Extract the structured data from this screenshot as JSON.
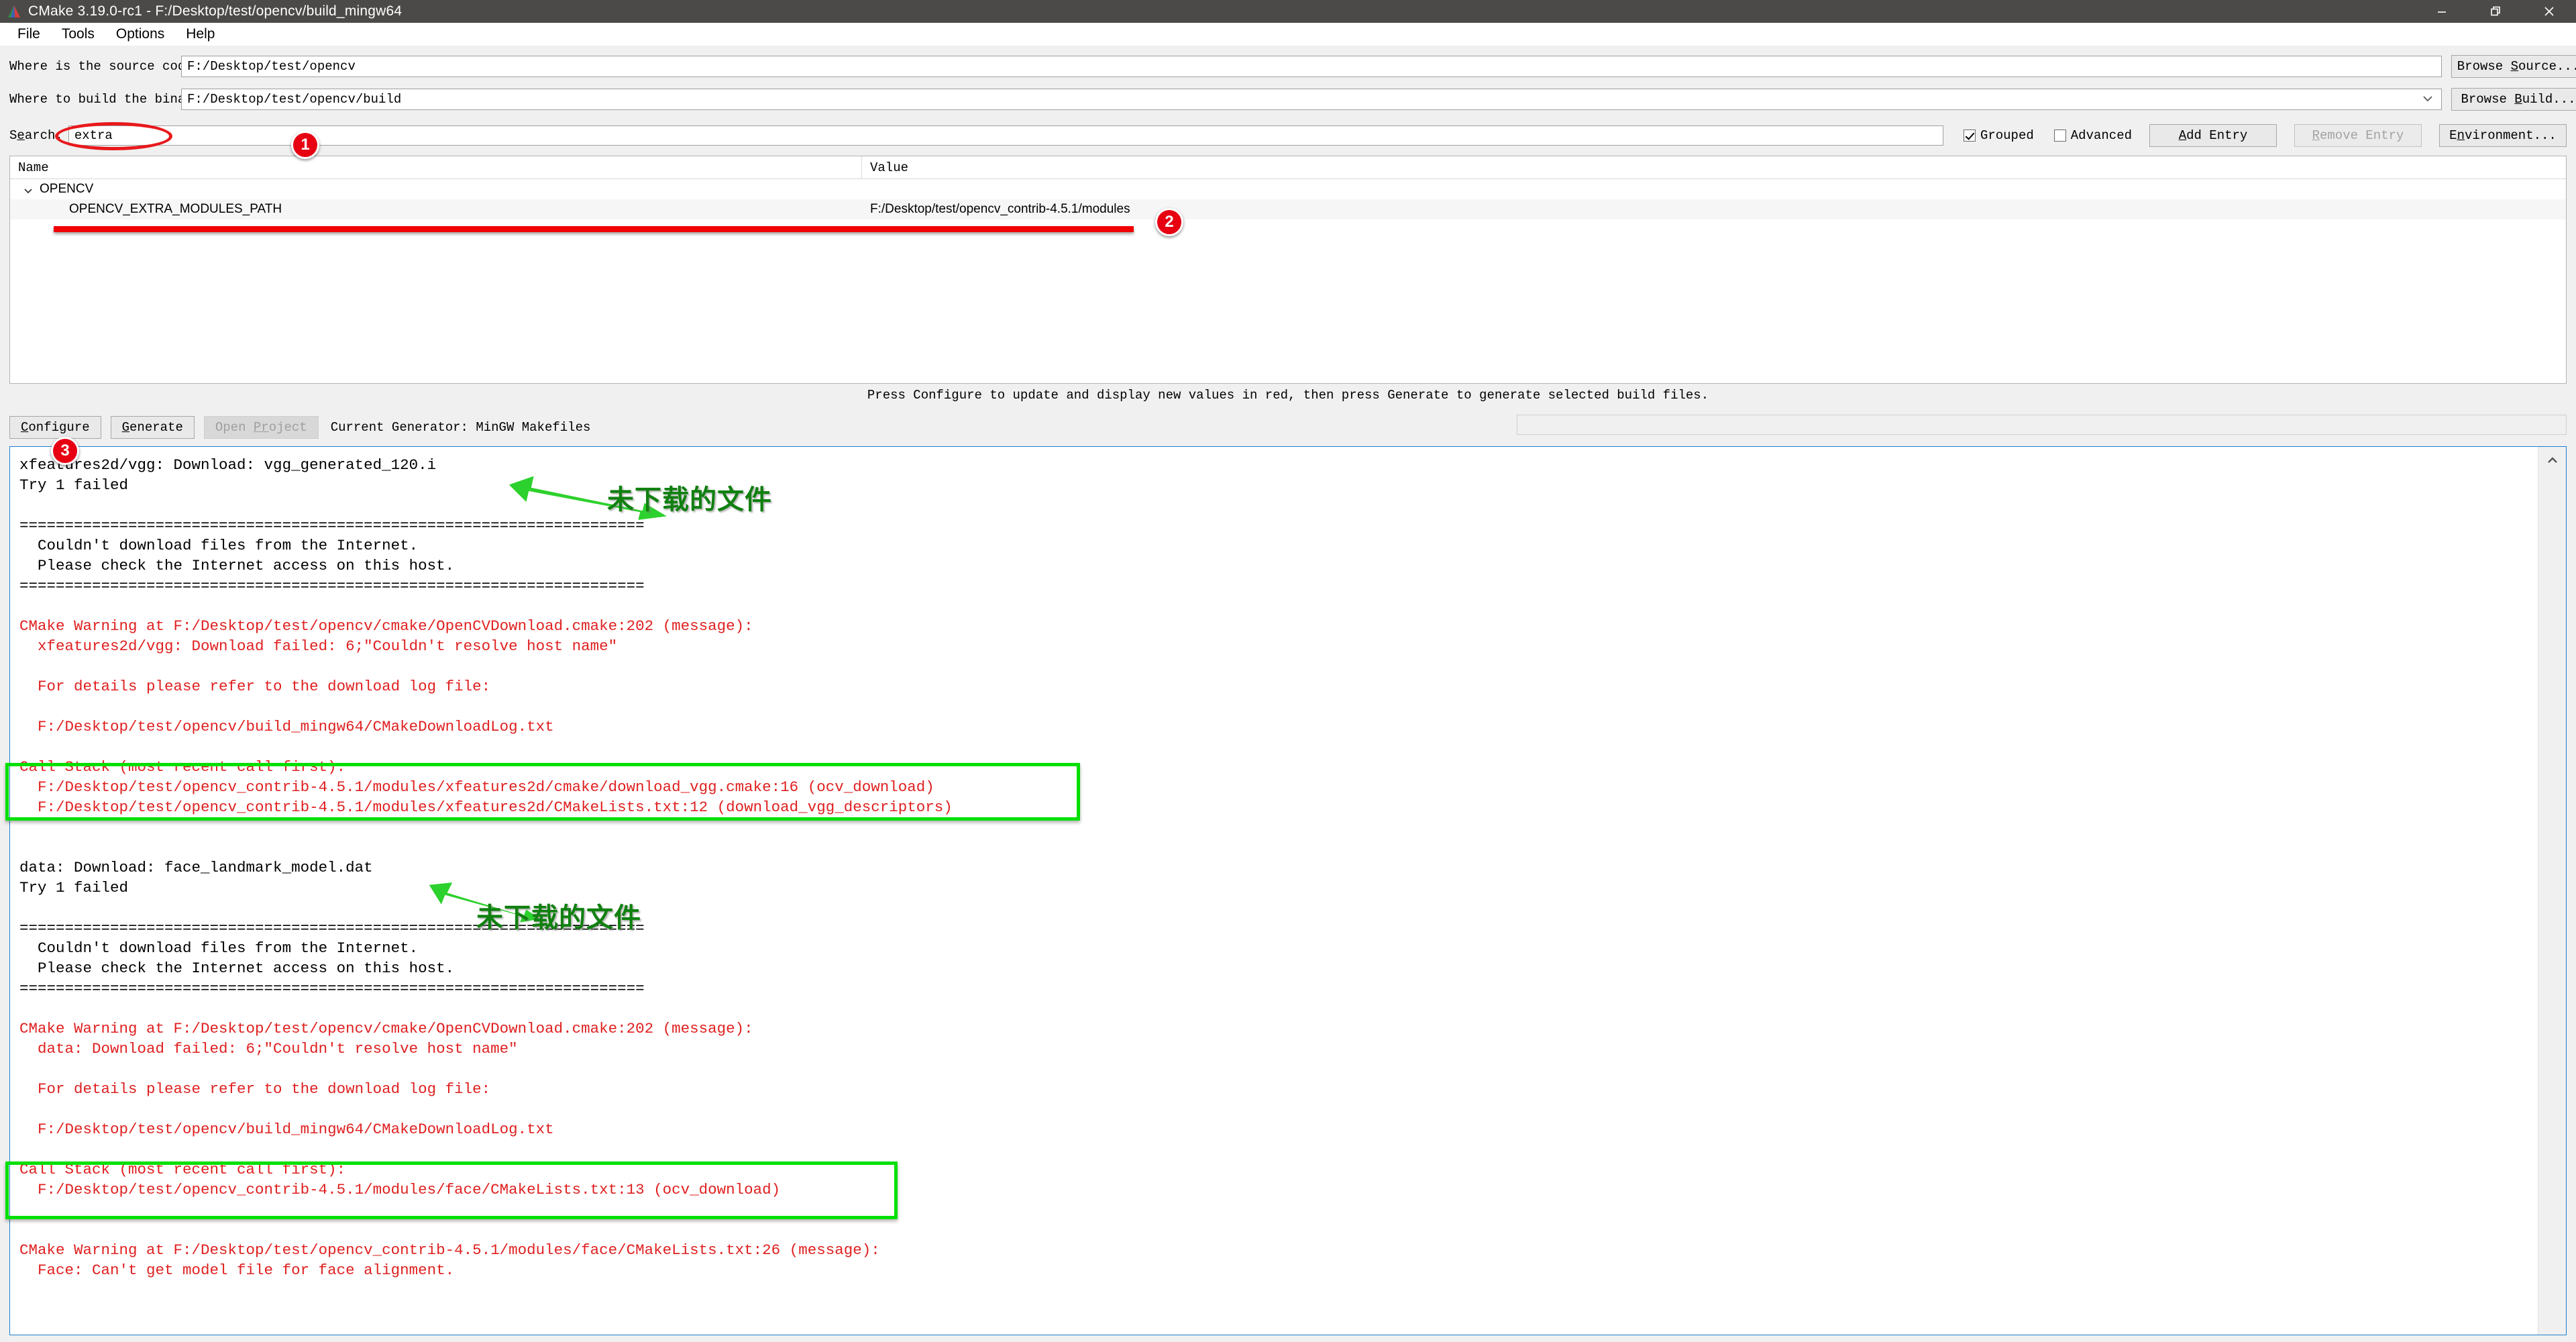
{
  "window": {
    "title": "CMake 3.19.0-rc1 - F:/Desktop/test/opencv/build_mingw64",
    "minimize": "—",
    "maximize": "❐",
    "close": "✕"
  },
  "menu": {
    "items": [
      "File",
      "Tools",
      "Options",
      "Help"
    ]
  },
  "paths": {
    "source_label": "Where is the source code:",
    "source_value": "F:/Desktop/test/opencv",
    "browse_source": "Browse Source...",
    "build_label": "Where to build the binaries:",
    "build_value": "F:/Desktop/test/opencv/build",
    "browse_build": "Browse Build..."
  },
  "search": {
    "label": "Search:",
    "value": "extra",
    "grouped_label": "Grouped",
    "grouped_checked": true,
    "advanced_label": "Advanced",
    "advanced_checked": false,
    "add_entry": "Add Entry",
    "remove_entry": "Remove Entry",
    "environment": "Environment..."
  },
  "cache": {
    "columns": [
      "Name",
      "Value"
    ],
    "group": "OPENCV",
    "rows": [
      {
        "name": "OPENCV_EXTRA_MODULES_PATH",
        "value": "F:/Desktop/test/opencv_contrib-4.5.1/modules"
      }
    ]
  },
  "hint": "Press Configure to update and display new values in red, then press Generate to generate selected build files.",
  "actions": {
    "configure": "Configure",
    "generate": "Generate",
    "open_project": "Open Project",
    "generator_text": "Current Generator: MinGW Makefiles"
  },
  "log": [
    {
      "text": "xfeatures2d/vgg: Download: vgg_generated_120.i",
      "err": false
    },
    {
      "text": "Try 1 failed",
      "err": false
    },
    {
      "text": "",
      "err": false
    },
    {
      "text": "=====================================================================",
      "err": false
    },
    {
      "text": "  Couldn't download files from the Internet.",
      "err": false
    },
    {
      "text": "  Please check the Internet access on this host.",
      "err": false
    },
    {
      "text": "=====================================================================",
      "err": false
    },
    {
      "text": "",
      "err": false
    },
    {
      "text": "CMake Warning at F:/Desktop/test/opencv/cmake/OpenCVDownload.cmake:202 (message):",
      "err": true
    },
    {
      "text": "  xfeatures2d/vgg: Download failed: 6;\"Couldn't resolve host name\"",
      "err": true
    },
    {
      "text": "",
      "err": true
    },
    {
      "text": "  For details please refer to the download log file:",
      "err": true
    },
    {
      "text": "",
      "err": true
    },
    {
      "text": "  F:/Desktop/test/opencv/build_mingw64/CMakeDownloadLog.txt",
      "err": true
    },
    {
      "text": "",
      "err": true
    },
    {
      "text": "Call Stack (most recent call first):",
      "err": true
    },
    {
      "text": "  F:/Desktop/test/opencv_contrib-4.5.1/modules/xfeatures2d/cmake/download_vgg.cmake:16 (ocv_download)",
      "err": true
    },
    {
      "text": "  F:/Desktop/test/opencv_contrib-4.5.1/modules/xfeatures2d/CMakeLists.txt:12 (download_vgg_descriptors)",
      "err": true
    },
    {
      "text": "",
      "err": true
    },
    {
      "text": "",
      "err": false
    },
    {
      "text": "data: Download: face_landmark_model.dat",
      "err": false
    },
    {
      "text": "Try 1 failed",
      "err": false
    },
    {
      "text": "",
      "err": false
    },
    {
      "text": "=====================================================================",
      "err": false
    },
    {
      "text": "  Couldn't download files from the Internet.",
      "err": false
    },
    {
      "text": "  Please check the Internet access on this host.",
      "err": false
    },
    {
      "text": "=====================================================================",
      "err": false
    },
    {
      "text": "",
      "err": false
    },
    {
      "text": "CMake Warning at F:/Desktop/test/opencv/cmake/OpenCVDownload.cmake:202 (message):",
      "err": true
    },
    {
      "text": "  data: Download failed: 6;\"Couldn't resolve host name\"",
      "err": true
    },
    {
      "text": "",
      "err": true
    },
    {
      "text": "  For details please refer to the download log file:",
      "err": true
    },
    {
      "text": "",
      "err": true
    },
    {
      "text": "  F:/Desktop/test/opencv/build_mingw64/CMakeDownloadLog.txt",
      "err": true
    },
    {
      "text": "",
      "err": true
    },
    {
      "text": "Call Stack (most recent call first):",
      "err": true
    },
    {
      "text": "  F:/Desktop/test/opencv_contrib-4.5.1/modules/face/CMakeLists.txt:13 (ocv_download)",
      "err": true
    },
    {
      "text": "",
      "err": true
    },
    {
      "text": "",
      "err": false
    },
    {
      "text": "CMake Warning at F:/Desktop/test/opencv_contrib-4.5.1/modules/face/CMakeLists.txt:26 (message):",
      "err": true
    },
    {
      "text": "  Face: Can't get model file for face alignment.",
      "err": true
    }
  ],
  "annotations": {
    "badges": [
      "1",
      "2",
      "3"
    ],
    "note_1": "未下载的文件",
    "note_2": "未下载的文件"
  },
  "colors": {
    "badge_red": "#e60012",
    "highlight_red": "#e8191c",
    "highlight_green": "#00e000",
    "error_text": "#e02020",
    "titlebar": "#4c4a48",
    "focus_border": "#1d7fd0"
  }
}
